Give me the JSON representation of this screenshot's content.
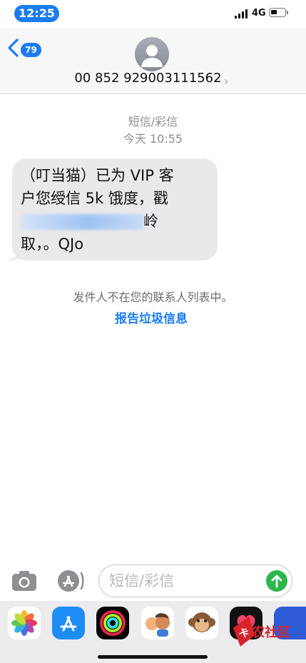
{
  "status_bar": {
    "time": "12:25",
    "network": "4G",
    "battery_level": 0.45
  },
  "header": {
    "back_badge": "79",
    "contact_number": "00 852 929003111562",
    "icons": [
      "back-chevron-icon",
      "person-icon",
      "chevron-right-icon"
    ]
  },
  "conversation": {
    "type_label": "短信/彩信",
    "timestamp": "今天 10:55",
    "message": {
      "line1": "（叮当猫）已为 VIP 客",
      "line2": "户您绶信 5k 饿度，戳",
      "line3_suffix": "岭",
      "line4": "取，。QJo"
    },
    "not_in_contacts": "发件人不在您的联系人列表中。",
    "report_junk": "报告垃圾信息"
  },
  "composer": {
    "placeholder": "短信/彩信",
    "accent_send": "#2cb64c",
    "icons": [
      "camera-icon",
      "app-store-icon",
      "send-arrow-icon"
    ]
  },
  "app_drawer": {
    "apps": [
      "photos-icon",
      "app-store-icon",
      "activity-icon",
      "memoji-icon",
      "animoji-monkey-icon",
      "digital-touch-icon",
      "more-app-icon"
    ]
  },
  "watermark": {
    "text": "卡农社区"
  },
  "colors": {
    "accent": "#1a7cf0",
    "bubble": "#e9e9eb",
    "secondary_text": "#8e8e93"
  }
}
